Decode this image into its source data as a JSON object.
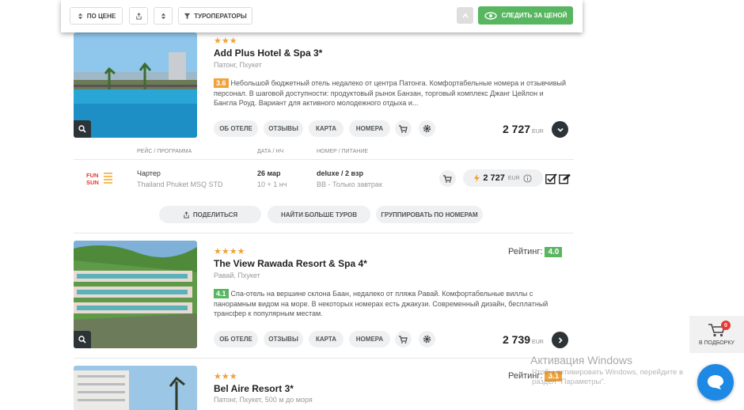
{
  "toolbar": {
    "sort_price": "ПО ЦЕНЕ",
    "operators": "ТУРОПЕРАТОРЫ",
    "track_price": "СЛЕДИТЬ ЗА ЦЕНОЙ"
  },
  "hotels": [
    {
      "stars": "★★★",
      "name": "Add Plus Hotel & Spa 3*",
      "location": "Патонг, Пхукет",
      "score": "3.6",
      "score_color": "#f0a23a",
      "description": "Небольшой бюджетный отель недалеко от центра Патонга. Комфортабельные номера и отзывчивый персонал. В шаговой доступности: продуктовый рынок Банзан, торговый комплекс Джанг Цейлон и Бангла Роуд. Вариант для активного молодежного отдыха и...",
      "tabs": [
        "ОБ ОТЕЛЕ",
        "ОТЗЫВЫ",
        "КАРТА",
        "НОМЕРА"
      ],
      "price": "2 727",
      "currency": "EUR"
    },
    {
      "stars": "★★★★",
      "name": "The View Rawada Resort & Spa 4*",
      "location": "Равай, Пхукет",
      "score": "4.1",
      "score_color": "#57b65f",
      "rating_label": "Рейтинг:",
      "rating_value": "4.0",
      "description": "Спа-отель на вершине склона Баан, недалеко от пляжа Равай. Комфортабельные виллы с панорамным видом на море. В некоторых номерах есть джакузи. Современный дизайн, бесплатный трансфер к популярным местам.",
      "tabs": [
        "ОБ ОТЕЛЕ",
        "ОТЗЫВЫ",
        "КАРТА",
        "НОМЕРА"
      ],
      "price": "2 739",
      "currency": "EUR"
    },
    {
      "stars": "★★★",
      "name": "Bel Aire Resort 3*",
      "location": "Патонг, Пхукет, 500 м до моря",
      "rating_label": "Рейтинг:",
      "rating_value": "3.1"
    }
  ],
  "tour_table": {
    "headers": [
      "РЕЙС / ПРОГРАММА",
      "ДАТА / НЧ",
      "НОМЕР / ПИТАНИЕ"
    ],
    "operator_logo": "FUN SUN",
    "flight": "Чартер",
    "program": "Thailand Phuket MSQ STD",
    "date": "26 мар",
    "nights": "10 + 1 нч",
    "room": "deluxe / 2 взр",
    "meal": "BB - Только завтрак",
    "price": "2 727",
    "currency": "EUR"
  },
  "actions": {
    "share": "ПОДЕЛИТЬСЯ",
    "find_more": "НАЙТИ БОЛЬШЕ ТУРОВ",
    "group_rooms": "ГРУППИРОВАТЬ ПО НОМЕРАМ"
  },
  "collection": {
    "count": "0",
    "label": "В ПОДБОРКУ"
  },
  "watermark": {
    "title": "Активация Windows",
    "text": "Чтобы активировать Windows, перейдите в раздел \"Параметры\"."
  }
}
